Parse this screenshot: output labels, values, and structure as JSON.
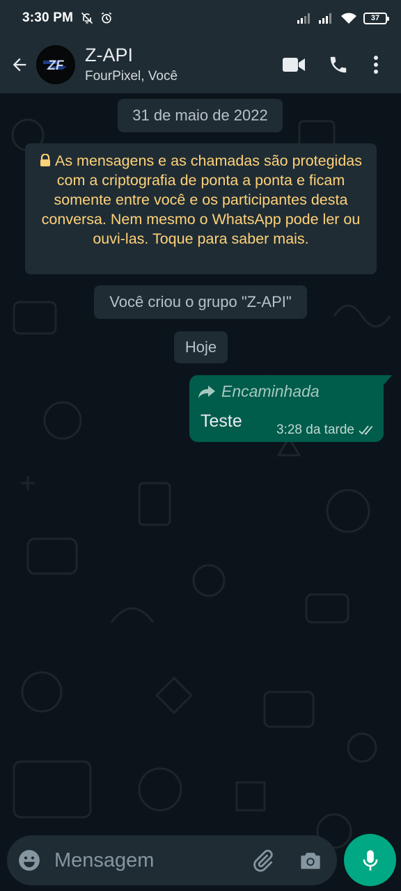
{
  "status_bar": {
    "time": "3:30 PM",
    "battery": "37",
    "icons": [
      "notifications-off-icon",
      "alarm-icon",
      "signal-icon",
      "signal-icon",
      "wifi-icon",
      "battery-icon"
    ]
  },
  "header": {
    "title": "Z-API",
    "subtitle": "FourPixel, Você",
    "avatar_text": "ZF",
    "icons": [
      "back-arrow-icon",
      "video-call-icon",
      "phone-icon",
      "more-vert-icon"
    ]
  },
  "chat": {
    "date_label": "31 de maio de 2022",
    "encryption_notice": "As mensagens e as chamadas são protegidas com a criptografia de ponta a ponta e ficam somente entre você e os participantes desta conversa. Nem mesmo o WhatsApp pode ler ou ouvi-las. Toque para saber mais.",
    "group_created": "Você criou o grupo \"Z-API\"",
    "today_label": "Hoje",
    "messages": [
      {
        "forwarded_label": "Encaminhada",
        "text": "Teste",
        "time": "3:28 da tarde",
        "status": "delivered"
      }
    ]
  },
  "composer": {
    "placeholder": "Mensagem",
    "value": "",
    "icons": [
      "emoji-icon",
      "attach-icon",
      "camera-icon",
      "mic-icon"
    ]
  },
  "colors": {
    "background": "#0b141a",
    "bar": "#1f2c34",
    "outgoing_bubble": "#005c4b",
    "notice_text": "#ffd279",
    "accent": "#00a884"
  }
}
